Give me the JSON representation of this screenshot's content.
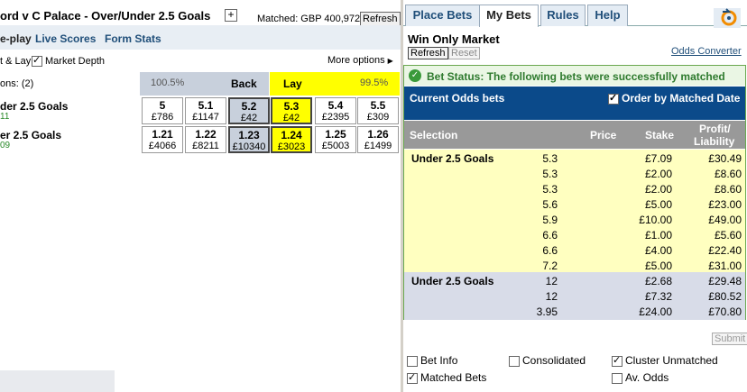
{
  "market": {
    "title": "ord v C Palace - Over/Under 2.5 Goals",
    "plus": "+",
    "matched": "Matched: GBP 400,972",
    "refresh": "Refresh"
  },
  "nav": {
    "inplay": "e-play",
    "live_scores": "Live Scores",
    "form_stats": "Form Stats"
  },
  "options": {
    "back_lay": "t & Lay",
    "market_depth": "Market Depth",
    "more_options": "More options"
  },
  "header": {
    "selections": "ons:  (2)",
    "back_pct": "100.5%",
    "back": "Back",
    "lay": "Lay",
    "lay_pct": "99.5%"
  },
  "runners": [
    {
      "name": "der 2.5 Goals",
      "sub": "11",
      "prices": [
        {
          "p": "5",
          "s": "£786"
        },
        {
          "p": "5.1",
          "s": "£1147"
        },
        {
          "p": "5.2",
          "s": "£42"
        },
        {
          "p": "5.3",
          "s": "£42"
        },
        {
          "p": "5.4",
          "s": "£2395"
        },
        {
          "p": "5.5",
          "s": "£309"
        }
      ]
    },
    {
      "name": "er 2.5 Goals",
      "sub": "09",
      "prices": [
        {
          "p": "1.21",
          "s": "£4066"
        },
        {
          "p": "1.22",
          "s": "£8211"
        },
        {
          "p": "1.23",
          "s": "£10340"
        },
        {
          "p": "1.24",
          "s": "£3023"
        },
        {
          "p": "1.25",
          "s": "£5003"
        },
        {
          "p": "1.26",
          "s": "£1499"
        }
      ]
    }
  ],
  "tabs": [
    "Place Bets",
    "My Bets",
    "Rules",
    "Help"
  ],
  "mybets": {
    "market_title": "Win Only Market",
    "refresh": "Refresh",
    "reset": "Reset",
    "odds_converter": "Odds Converter",
    "status": "Bet Status: The following bets were successfully matched",
    "current": "Current Odds bets",
    "order": "Order by Matched Date",
    "columns": {
      "selection": "Selection",
      "price": "Price",
      "stake": "Stake",
      "profit1": "Profit/",
      "profit2": "Liability"
    },
    "groups": [
      {
        "selection": "Under 2.5 Goals",
        "rows": [
          {
            "price": "5.3",
            "stake": "£7.09",
            "pl": "£30.49"
          },
          {
            "price": "5.3",
            "stake": "£2.00",
            "pl": "£8.60"
          },
          {
            "price": "5.3",
            "stake": "£2.00",
            "pl": "£8.60"
          },
          {
            "price": "5.6",
            "stake": "£5.00",
            "pl": "£23.00"
          },
          {
            "price": "5.9",
            "stake": "£10.00",
            "pl": "£49.00"
          },
          {
            "price": "6.6",
            "stake": "£1.00",
            "pl": "£5.60"
          },
          {
            "price": "6.6",
            "stake": "£4.00",
            "pl": "£22.40"
          },
          {
            "price": "7.2",
            "stake": "£5.00",
            "pl": "£31.00"
          }
        ]
      },
      {
        "selection": "Under 2.5 Goals",
        "rows": [
          {
            "price": "12",
            "stake": "£2.68",
            "pl": "£29.48"
          },
          {
            "price": "12",
            "stake": "£7.32",
            "pl": "£80.52"
          },
          {
            "price": "3.95",
            "stake": "£24.00",
            "pl": "£70.80"
          }
        ]
      }
    ],
    "submit": "Submit",
    "opts": {
      "bet_info": "Bet Info",
      "consolidated": "Consolidated",
      "cluster_unmatched": "Cluster Unmatched",
      "matched_bets": "Matched Bets",
      "av_odds": "Av. Odds"
    }
  },
  "colors": {
    "back": "#c8d0dc",
    "lay": "#ffff00",
    "band": "#0b4a8a",
    "yellow_rows": "#ffffc0",
    "blue_rows": "#d8dce8"
  }
}
